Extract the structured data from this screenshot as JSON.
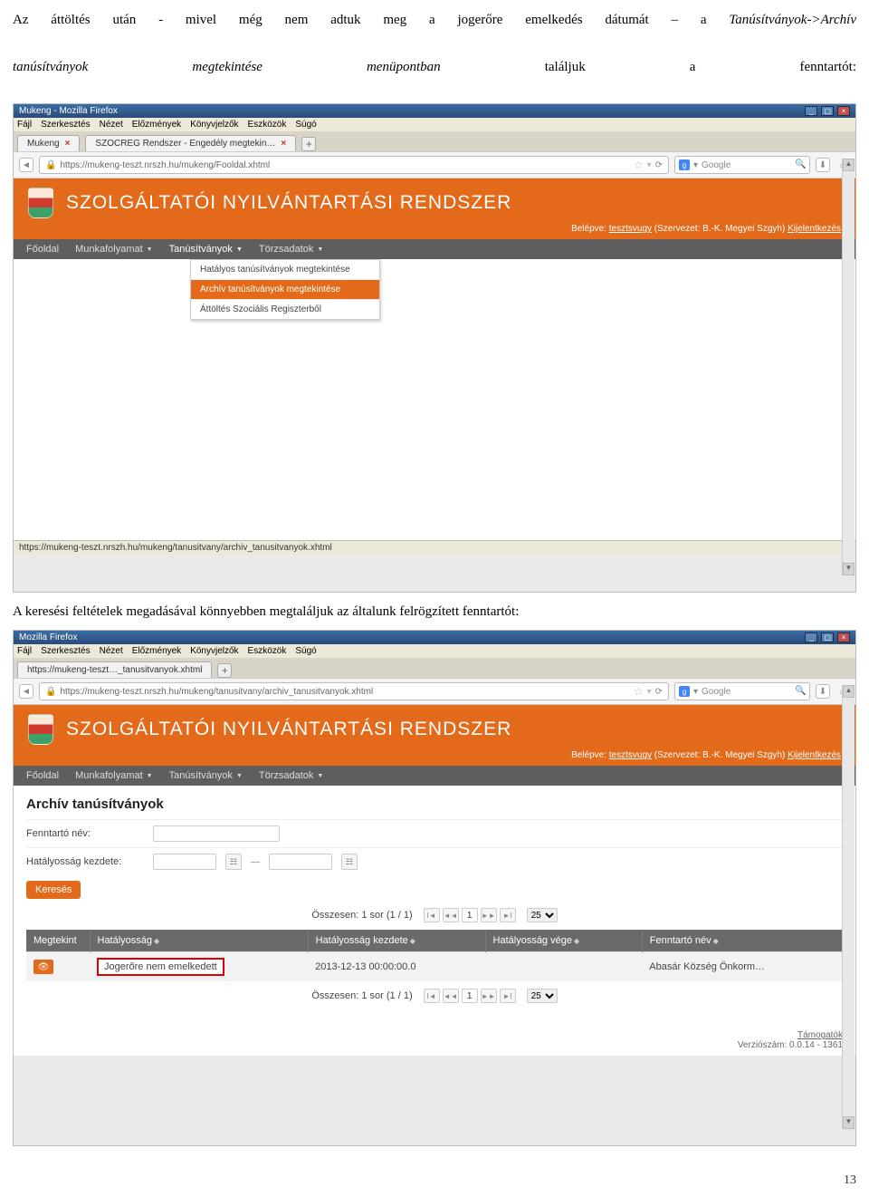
{
  "intro": {
    "line": "Az áttöltés után - mivel még nem adtuk meg a jogerőre emelkedés dátumát – a ",
    "italic1": "Tanúsítványok->Archív",
    "line2a": "tanúsítványok",
    "line2b": "megtekintése",
    "line2c": "menüpontban",
    "line2d": "találjuk",
    "line2e": "a",
    "line2f": "fenntartót:"
  },
  "para2": "A keresési feltételek megadásával könnyebben megtaláljuk az általunk felrögzített fenntartót:",
  "page_number": "13",
  "ff": {
    "title1": "Mukeng - Mozilla Firefox",
    "title2": "Mozilla Firefox",
    "menu": [
      "Fájl",
      "Szerkesztés",
      "Nézet",
      "Előzmények",
      "Könyvjelzők",
      "Eszközök",
      "Súgó"
    ],
    "tab1a": "Mukeng",
    "tab1b": "SZOCREG Rendszer - Engedély megtekin…",
    "tab2": "https://mukeng-teszt…_tanusitvanyok.xhtml",
    "url1": "https://mukeng-teszt.nrszh.hu/mukeng/Fooldal.xhtml",
    "url2": "https://mukeng-teszt.nrszh.hu/mukeng/tanusitvany/archiv_tanusitvanyok.xhtml",
    "search_ph": "Google",
    "status1": "https://mukeng-teszt.nrszh.hu/mukeng/tanusitvany/archiv_tanusitvanyok.xhtml"
  },
  "app": {
    "title": "SZOLGÁLTATÓI NYILVÁNTARTÁSI RENDSZER",
    "login_prefix": "Belépve: ",
    "login_user": "tesztsvugy",
    "login_org": "  (Szervezet: B.-K. Megyei Szgyh)  ",
    "logout": "Kijelentkezés",
    "nav": [
      "Főoldal",
      "Munkafolyamat",
      "Tanúsítványok",
      "Törzsadatok"
    ],
    "dropdown": [
      "Hatályos tanúsítványok megtekintése",
      "Archív tanúsítványok megtekintése",
      "Áttöltés Szociális Regiszterből"
    ]
  },
  "panel": {
    "heading": "Archív tanúsítványok",
    "label_name": "Fenntartó név:",
    "label_date": "Hatályosság kezdete:",
    "search_btn": "Keresés",
    "summary": "Összesen: 1 sor (1 / 1)",
    "pagesize": "25",
    "cols": [
      "Megtekint",
      "Hatályosság",
      "Hatályosság kezdete",
      "Hatályosság vége",
      "Fenntartó név"
    ],
    "row": {
      "status": "Jogerőre nem emelkedett",
      "start": "2013-12-13 00:00:00.0",
      "end": "",
      "name": "Abasár Község Önkorm…"
    },
    "sponsors": "Támogatók",
    "version": "Verziószám: 0.0.14 - 1361"
  }
}
